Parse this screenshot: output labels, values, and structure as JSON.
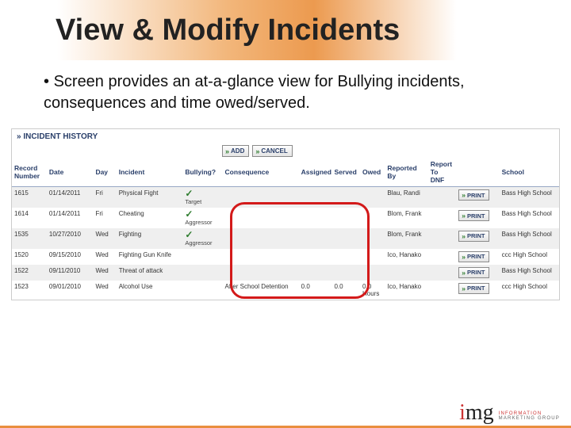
{
  "page_title": "View & Modify Incidents",
  "subtitle_bullet": "• ",
  "subtitle_text": "Screen provides an at-a-glance view for Bullying incidents, consequences and time owed/served.",
  "section_header": "»  INCIDENT HISTORY",
  "toolbar": {
    "add": "ADD",
    "cancel": "CANCEL"
  },
  "columns": {
    "record_number_l1": "Record",
    "record_number_l2": "Number",
    "date": "Date",
    "day": "Day",
    "incident": "Incident",
    "bullying": "Bullying?",
    "consequence": "Consequence",
    "assigned": "Assigned",
    "served": "Served",
    "owed": "Owed",
    "reported_l1": "Reported",
    "reported_l2": "By",
    "report_dnf_l1": "Report",
    "report_dnf_l2": "To",
    "report_dnf_l3": "DNF",
    "print_col": "",
    "school": "School"
  },
  "rows": [
    {
      "rec": "1615",
      "date": "01/14/2011",
      "day": "Fri",
      "incident": "Physical Fight",
      "bullying_check": true,
      "bullying_role": "Target",
      "consequence": "",
      "assigned": "",
      "served": "",
      "owed": "",
      "reported_by": "Blau, Randi",
      "school": "Bass High School"
    },
    {
      "rec": "1614",
      "date": "01/14/2011",
      "day": "Fri",
      "incident": "Cheating",
      "bullying_check": true,
      "bullying_role": "Aggressor",
      "consequence": "",
      "assigned": "",
      "served": "",
      "owed": "",
      "reported_by": "Blom, Frank",
      "school": "Bass High School"
    },
    {
      "rec": "1535",
      "date": "10/27/2010",
      "day": "Wed",
      "incident": "Fighting",
      "bullying_check": true,
      "bullying_role": "Aggressor",
      "consequence": "",
      "assigned": "",
      "served": "",
      "owed": "",
      "reported_by": "Blom, Frank",
      "school": "Bass High School"
    },
    {
      "rec": "1520",
      "date": "09/15/2010",
      "day": "Wed",
      "incident": "Fighting Gun Knife",
      "bullying_check": false,
      "bullying_role": "",
      "consequence": "",
      "assigned": "",
      "served": "",
      "owed": "",
      "reported_by": "Ico, Hanako",
      "school": "ccc High School"
    },
    {
      "rec": "1522",
      "date": "09/11/2010",
      "day": "Wed",
      "incident": "Threat of attack",
      "bullying_check": false,
      "bullying_role": "",
      "consequence": "",
      "assigned": "",
      "served": "",
      "owed": "",
      "reported_by": "",
      "school": "Bass High School"
    },
    {
      "rec": "1523",
      "date": "09/01/2010",
      "day": "Wed",
      "incident": "Alcohol Use",
      "bullying_check": false,
      "bullying_role": "",
      "consequence": "After School Detention",
      "assigned": "0.0",
      "served": "0.0",
      "owed": "0.0 Hours",
      "reported_by": "Ico, Hanako",
      "school": "ccc High School"
    }
  ],
  "print_label": "PRINT",
  "logo": {
    "img": "img",
    "l1": "INFORMATION",
    "l2": "MARKETING GROUP"
  }
}
